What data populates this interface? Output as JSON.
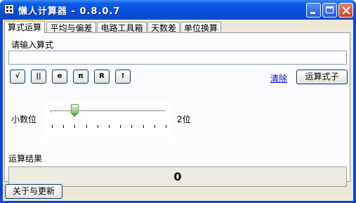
{
  "window": {
    "title": "懒人计算器 - 0.8.0.7"
  },
  "tabs": [
    {
      "label": "算式运算",
      "active": true
    },
    {
      "label": "平均与偏差",
      "active": false
    },
    {
      "label": "电路工具箱",
      "active": false
    },
    {
      "label": "天数差",
      "active": false
    },
    {
      "label": "单位换算",
      "active": false
    }
  ],
  "calc": {
    "input_label": "请输入算式",
    "input_value": "",
    "symbol_buttons": [
      {
        "label": "√",
        "icon": "sqrt-icon"
      },
      {
        "label": "||",
        "icon": "abs-icon"
      },
      {
        "label": "e",
        "icon": "e-icon"
      },
      {
        "label": "π",
        "icon": "pi-icon"
      },
      {
        "label": "R",
        "icon": "r-icon"
      },
      {
        "label": "!",
        "icon": "factorial-icon"
      }
    ],
    "clear_link": "清除",
    "calculate_button": "运算式子",
    "decimal_label": "小数位",
    "decimal_value": 2,
    "decimal_max": 10,
    "decimal_readout": "2位",
    "result_label": "运算结果",
    "result_value": "0"
  },
  "footer": {
    "about_button": "关于与更新"
  },
  "colors": {
    "title_bar": "#0550dc",
    "tab_highlight": "#ffc83c",
    "link": "#0000ff",
    "close_button": "#c7401f"
  }
}
